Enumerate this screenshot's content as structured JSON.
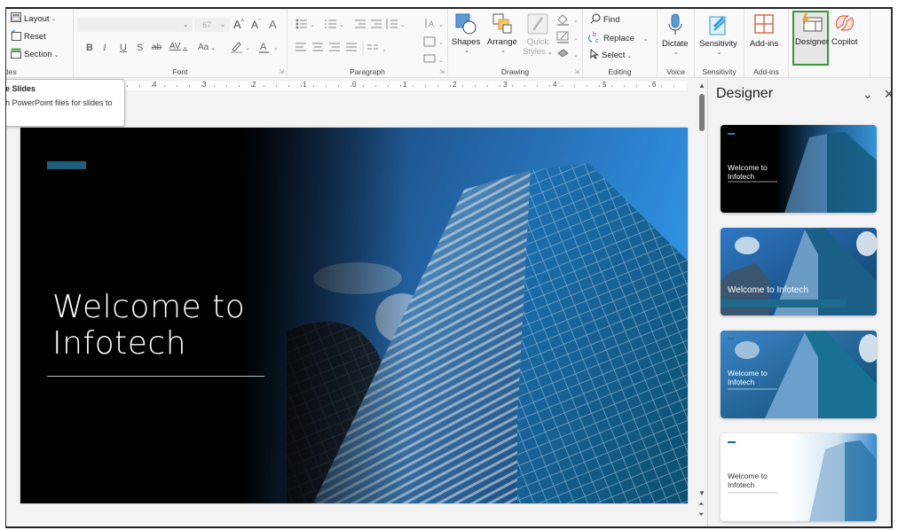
{
  "ribbon": {
    "slides_group": {
      "label_partial": "des",
      "layout": "Layout",
      "reset": "Reset",
      "section": "Section"
    },
    "font_group": {
      "label": "Font",
      "font_name": "",
      "font_size": "67",
      "bold": "B",
      "italic": "I",
      "underline": "U",
      "shadow": "S",
      "strikethrough": "ab",
      "spacing": "AV",
      "change_case": "Aa",
      "grow": "A",
      "shrink": "A",
      "clear": "A"
    },
    "paragraph_group": {
      "label": "Paragraph"
    },
    "drawing_group": {
      "label": "Drawing",
      "shapes": "Shapes",
      "arrange": "Arrange",
      "quick_styles_1": "Quick",
      "quick_styles_2": "Styles"
    },
    "editing_group": {
      "label": "Editing",
      "find": "Find",
      "replace": "Replace",
      "select": "Select"
    },
    "voice_group": {
      "label": "Voice",
      "dictate": "Dictate"
    },
    "sensitivity_group": {
      "label": "Sensitivity",
      "sensitivity": "Sensitivity"
    },
    "addins_group": {
      "label": "Add-ins",
      "addins": "Add-ins"
    },
    "designer": "Designer",
    "copilot": "Copilot"
  },
  "tooltip": {
    "title_partial": "e Slides",
    "body_partial": "h PowerPoint files for slides to"
  },
  "ruler": {
    "labels": [
      "4",
      "3",
      "2",
      "1",
      "0",
      "1",
      "2",
      "3",
      "4",
      "5",
      "6"
    ]
  },
  "slide": {
    "title_line1": "Welcome to",
    "title_line2": "Infotech",
    "accent_color": "#1f5f7e"
  },
  "designer_pane": {
    "title": "Designer",
    "collapse_icon": "chevron-down-icon",
    "close_icon": "close-icon",
    "thumbnails": [
      {
        "line1": "Welcome to",
        "line2": "Infotech",
        "style": "dark-left"
      },
      {
        "line1": "Welcome to Infotech",
        "line2": "",
        "style": "photo-banner"
      },
      {
        "line1": "Welcome to",
        "line2": "Infotech",
        "style": "photo-overlay"
      },
      {
        "line1": "Welcome to",
        "line2": "Infotech",
        "style": "light-left"
      }
    ]
  },
  "colors": {
    "designer_highlight": "#3a9a3a",
    "accent": "#1f5f7e"
  }
}
